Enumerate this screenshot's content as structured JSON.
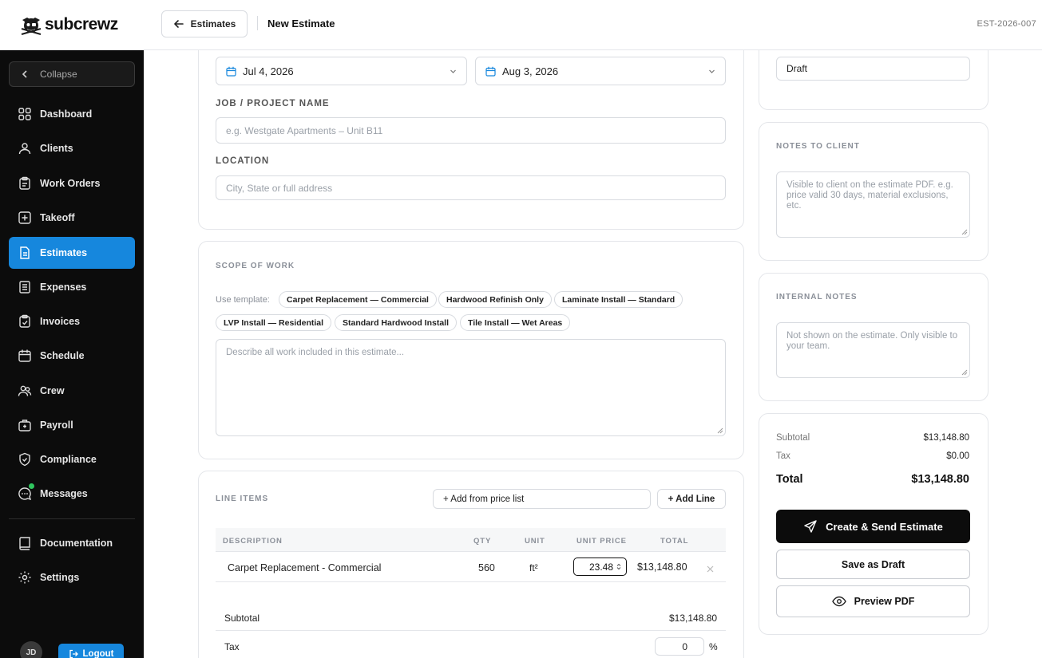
{
  "brand": {
    "name": "subcrewz"
  },
  "header": {
    "back_label": "Estimates",
    "title": "New Estimate",
    "doc_id": "EST-2026-007"
  },
  "sidebar": {
    "collapse_label": "Collapse",
    "items": [
      {
        "label": "Dashboard",
        "icon": "grid-icon"
      },
      {
        "label": "Clients",
        "icon": "users-icon"
      },
      {
        "label": "Work Orders",
        "icon": "clipboard-icon"
      },
      {
        "label": "Takeoff",
        "icon": "plus-square-icon"
      },
      {
        "label": "Estimates",
        "icon": "document-icon",
        "active": true
      },
      {
        "label": "Expenses",
        "icon": "receipt-icon"
      },
      {
        "label": "Invoices",
        "icon": "invoice-icon"
      },
      {
        "label": "Schedule",
        "icon": "calendar-icon"
      },
      {
        "label": "Crew",
        "icon": "crew-icon"
      },
      {
        "label": "Payroll",
        "icon": "briefcase-icon"
      },
      {
        "label": "Compliance",
        "icon": "shield-icon"
      },
      {
        "label": "Messages",
        "icon": "chat-icon"
      },
      {
        "label": "Documentation",
        "icon": "book-icon"
      },
      {
        "label": "Settings",
        "icon": "gear-icon"
      }
    ],
    "user_initials": "JD",
    "logout_label": "Logout"
  },
  "details": {
    "start_date": "Jul 4, 2026",
    "end_date": "Aug 3, 2026",
    "job_label": "JOB / PROJECT NAME",
    "job_placeholder": "e.g. Westgate Apartments – Unit B11",
    "location_label": "LOCATION",
    "location_placeholder": "City, State or full address"
  },
  "scope": {
    "title": "SCOPE OF WORK",
    "template_label": "Use template:",
    "templates": [
      "Carpet Replacement — Commercial",
      "Hardwood Refinish Only",
      "Laminate Install — Standard",
      "LVP Install — Residential",
      "Standard Hardwood Install",
      "Tile Install — Wet Areas"
    ],
    "placeholder": "Describe all work included in this estimate..."
  },
  "line_items": {
    "title": "LINE ITEMS",
    "price_list_label": "+ Add from price list",
    "add_line_label": "+ Add Line",
    "columns": {
      "description": "DESCRIPTION",
      "qty": "QTY",
      "unit": "UNIT",
      "unit_price": "UNIT PRICE",
      "total": "TOTAL"
    },
    "rows": [
      {
        "description": "Carpet Replacement - Commercial",
        "qty": "560",
        "unit": "ft²",
        "unit_price": "23.48",
        "total": "$13,148.80"
      }
    ],
    "subtotal_label": "Subtotal",
    "subtotal_value": "$13,148.80",
    "tax_label": "Tax",
    "tax_value": "0",
    "tax_unit": "%"
  },
  "status": {
    "value": "Draft"
  },
  "notes_client": {
    "title": "NOTES TO CLIENT",
    "placeholder": "Visible to client on the estimate PDF. e.g. price valid 30 days, material exclusions, etc."
  },
  "notes_internal": {
    "title": "INTERNAL NOTES",
    "placeholder": "Not shown on the estimate. Only visible to your team."
  },
  "summary": {
    "subtotal_label": "Subtotal",
    "subtotal_value": "$13,148.80",
    "tax_label": "Tax",
    "tax_value": "$0.00",
    "total_label": "Total",
    "total_value": "$13,148.80",
    "create_label": "Create & Send Estimate",
    "draft_label": "Save as Draft",
    "preview_label": "Preview PDF"
  },
  "colors": {
    "accent": "#1687dd",
    "sidebar_bg": "#0c0c0c",
    "online_dot": "#2fc55e"
  }
}
